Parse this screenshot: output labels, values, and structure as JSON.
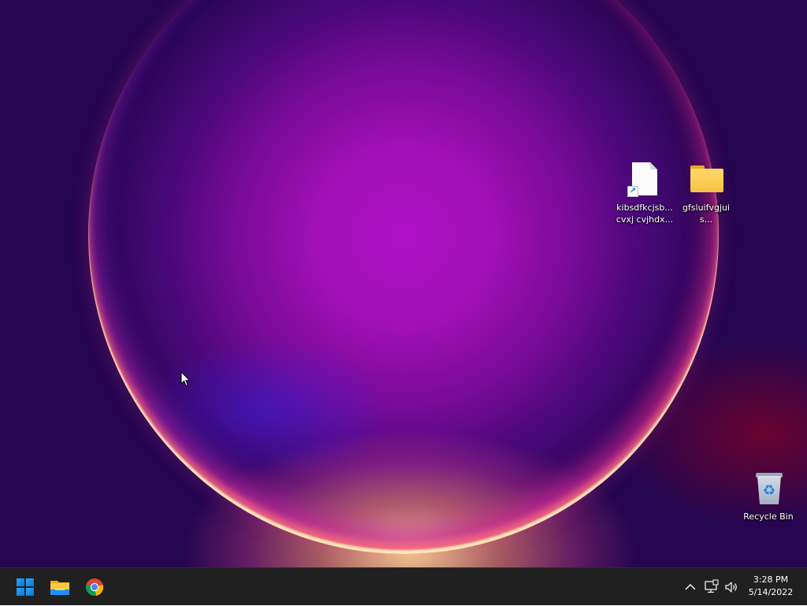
{
  "desktop": {
    "icons": [
      {
        "label": "kibsdfkcjsb... cvxj cvjhdx...",
        "icon": "shortcut-file-icon"
      },
      {
        "label": "gfsluifvgjuis...",
        "icon": "folder-icon"
      },
      {
        "label": "Recycle Bin",
        "icon": "recycle-bin-icon"
      }
    ]
  },
  "taskbar": {
    "pinned": [
      {
        "name": "Start",
        "icon": "windows-logo-icon"
      },
      {
        "name": "File Explorer",
        "icon": "file-explorer-icon"
      },
      {
        "name": "Google Chrome",
        "icon": "chrome-icon"
      }
    ],
    "tray": {
      "icons": [
        "chevron-up-icon",
        "network-icon",
        "volume-icon"
      ],
      "time": "3:28 PM",
      "date": "5/14/2022"
    }
  },
  "colors": {
    "taskbar": "#202020",
    "accent": "#0078d4",
    "folder": "#f6c244"
  }
}
